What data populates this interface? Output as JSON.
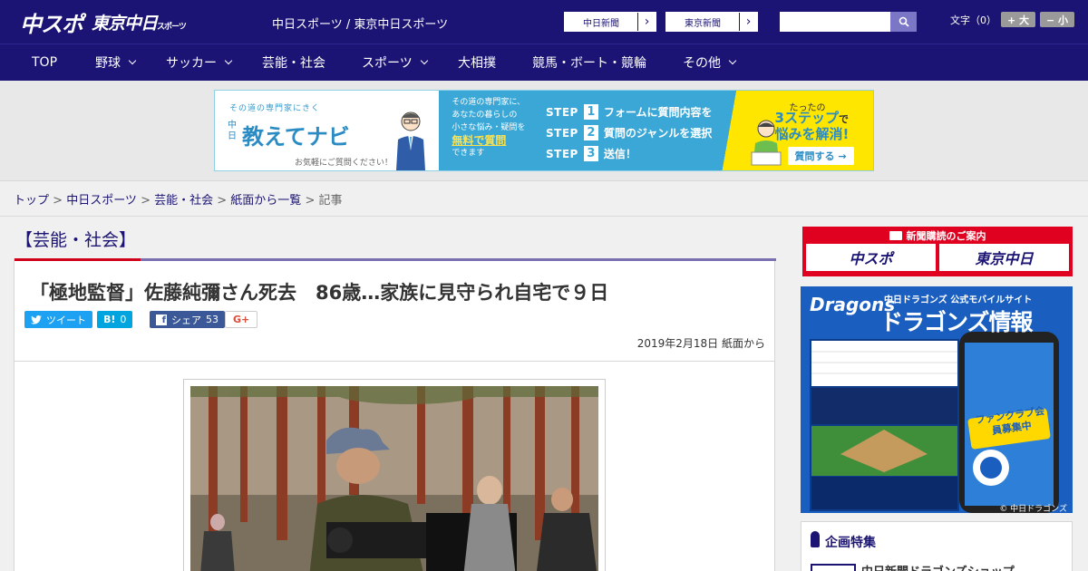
{
  "header": {
    "logo_chuspo": "中スポ",
    "logo_tokyo": "東京中日",
    "logo_tokyo_small": "スポーツ",
    "site_sub": "中日スポーツ / 東京中日スポーツ",
    "btn_chunichi": "中日新聞",
    "btn_tokyo": "東京新聞",
    "arrow": "›",
    "search_placeholder": "",
    "font_label": "文字（0）",
    "font_large": "+ 大",
    "font_small": "− 小"
  },
  "nav": {
    "items": [
      {
        "label": "TOP",
        "chevron": false
      },
      {
        "label": "野球",
        "chevron": true
      },
      {
        "label": "サッカー",
        "chevron": true
      },
      {
        "label": "芸能・社会",
        "chevron": false
      },
      {
        "label": "スポーツ",
        "chevron": true
      },
      {
        "label": "大相撲",
        "chevron": false
      },
      {
        "label": "競馬・ボート・競輪",
        "chevron": false
      },
      {
        "label": "その他",
        "chevron": true
      }
    ]
  },
  "ad": {
    "kicker": "その道の専門家にきく",
    "name": "教えてナビ",
    "chunichi_small": "中日",
    "caption": "お気軽にご質問ください！",
    "desc_lines": [
      "その道の専門家に、",
      "あなたの暮らしの",
      "小さな悩み・疑問を"
    ],
    "free": "無料で質問",
    "desc_end": "できます",
    "step_label": "STEP",
    "steps": [
      {
        "num": "1",
        "text": "フォームに質問内容を入力"
      },
      {
        "num": "2",
        "text": "質問のジャンルを選択"
      },
      {
        "num": "3",
        "text": "送信！"
      }
    ],
    "tagline_small": "たったの",
    "tagline_big": "3ステップ",
    "tagline_de": "で",
    "tagline_2": "悩みを解消!",
    "question_btn": "質問する →"
  },
  "breadcrumb": {
    "items": [
      "トップ",
      "中日スポーツ",
      "芸能・社会",
      "紙面から一覧"
    ],
    "separator": " > ",
    "current": "記事"
  },
  "category": "【芸能・社会】",
  "article": {
    "title": "「極地監督」佐藤純彌さん死去　86歳…家族に見守られ自宅で９日",
    "date_line": "2019年2月18日 紙面から"
  },
  "share": {
    "tweet": "ツイート",
    "hatena_label": "B!",
    "hatena_count": "0",
    "fb_label": "シェア",
    "fb_count": "53",
    "gplus": "G+"
  },
  "sidebar": {
    "subscribe_head": "新聞購読のご案内",
    "subscribe_a": "中スポ",
    "subscribe_b": "東京中日",
    "promo_brand": "Dragons",
    "promo_sub": "中日ドラゴンズ 公式モバイルサイト",
    "promo_title": "ドラゴンズ情報",
    "promo_badge": "ファンクラブ会員募集中",
    "promo_footer": "© 中日ドラゴンズ",
    "special_head": "企画特集",
    "special_item": "中日新聞ドラゴンズショップ"
  },
  "colors": {
    "brand_navy": "#1b1474",
    "accent_red": "#d0021b",
    "accent_purple": "#7a6fb0",
    "twitter": "#1da1f2",
    "hatena": "#00a4de",
    "facebook": "#3b5998"
  }
}
